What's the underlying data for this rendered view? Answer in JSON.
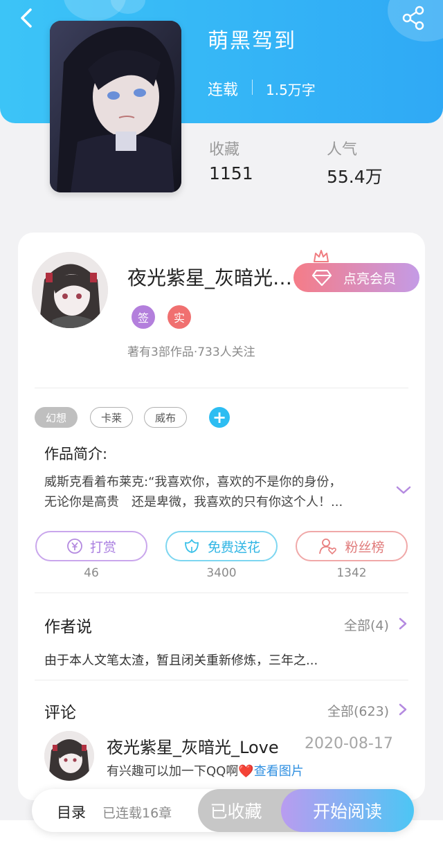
{
  "header": {
    "back_icon": "chevron-left-icon",
    "share_icon": "share-icon",
    "colors": {
      "gradient_start": "#3cc4f7",
      "gradient_end": "#2fa9f5"
    }
  },
  "book": {
    "title": "萌黑驾到",
    "status": "连载",
    "word_count": "1.5万字",
    "stats": [
      {
        "label": "收藏",
        "value": "1151"
      },
      {
        "label": "人气",
        "value": "55.4万"
      }
    ]
  },
  "author": {
    "name": "夜光紫星_灰暗光_Love",
    "badges": [
      {
        "label": "签",
        "color": "#b37fdc"
      },
      {
        "label": "实",
        "color": "#f07070"
      }
    ],
    "works_info": "著有3部作品·733人关注",
    "vip_button": "点亮会员"
  },
  "tags": [
    "幻想",
    "卡莱",
    "威布"
  ],
  "intro": {
    "title": "作品简介:",
    "lines": [
      "威斯克看着布莱克:“我喜欢你，喜欢的不是你的身份，",
      "无论你是高贵　还是卑微，我喜欢的只有你这个人！..."
    ]
  },
  "actions": [
    {
      "label": "打赏",
      "count": "46",
      "icon": "yen-coin-icon",
      "color": "#b48ae0"
    },
    {
      "label": "免费送花",
      "count": "3400",
      "icon": "flower-icon",
      "color": "#38c0e8"
    },
    {
      "label": "粉丝榜",
      "count": "1342",
      "icon": "user-heart-icon",
      "color": "#e88080"
    }
  ],
  "author_says": {
    "title": "作者说",
    "more": "全部(4)",
    "text": "由于本人文笔太渣，暂且闭关重新修炼，三年之..."
  },
  "comments": {
    "title": "评论",
    "more": "全部(623)",
    "items": [
      {
        "user": "夜光紫星_灰暗光_Love",
        "date": "2020-08-17",
        "text": "有兴趣可以加一下QQ啊",
        "emoji": "❤️",
        "link": "查看图片"
      }
    ]
  },
  "bottom_bar": {
    "toc": "目录",
    "toc_sub": "已连载16章",
    "favorited": "已收藏",
    "start_reading": "开始阅读"
  }
}
